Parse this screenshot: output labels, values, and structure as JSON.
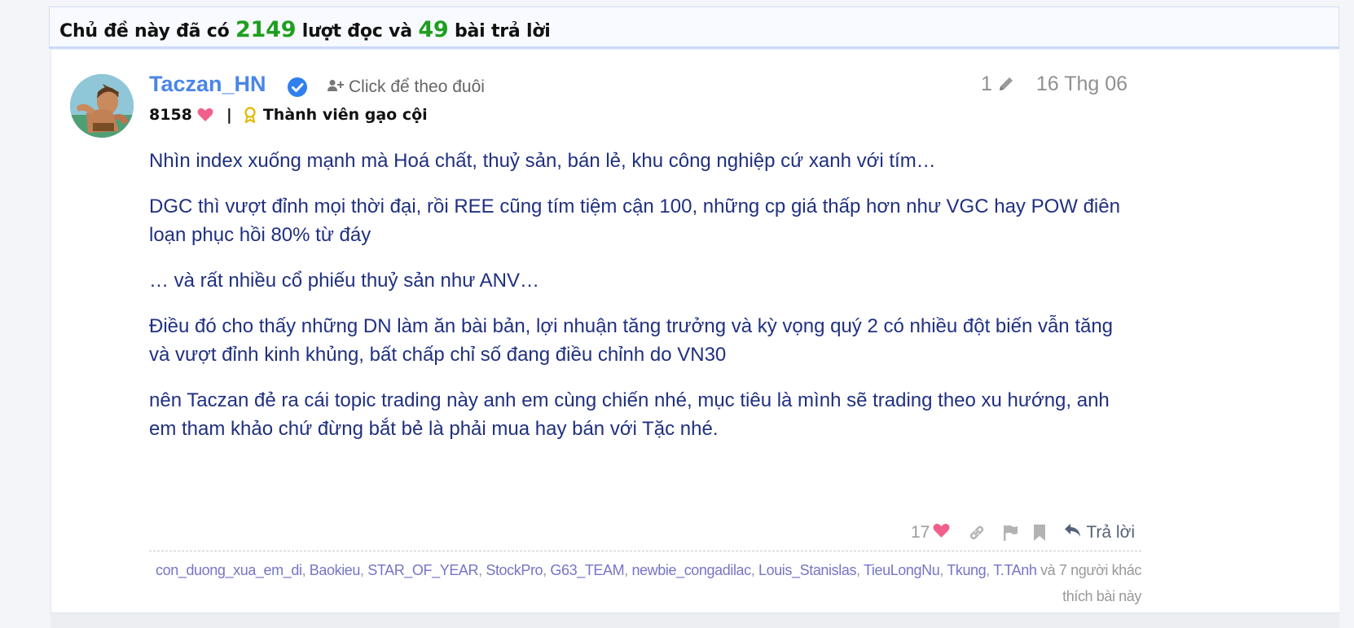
{
  "topic_header": {
    "prefix": "Chủ đề này đã có",
    "views": "2149",
    "middle": "lượt đọc và",
    "replies": "49",
    "suffix": "bài trả lời"
  },
  "post": {
    "username": "Taczan_HN",
    "follow_label": "Click để theo đuôi",
    "hearts": "8158",
    "rank": "Thành viên gạo cội",
    "post_number": "1",
    "date": "16 Thg 06",
    "paragraphs": [
      "Nhìn index xuống mạnh mà Hoá chất, thuỷ sản, bán lẻ, khu công nghiệp cứ xanh với tím…",
      "DGC thì vượt đỉnh mọi thời đại, rồi REE cũng tím tiệm cận 100, những cp giá thấp hơn như VGC hay POW điên loạn phục hồi 80% từ đáy",
      "… và rất nhiều cổ phiếu thuỷ sản như ANV…",
      "Điều đó cho thấy những DN làm ăn bài bản, lợi nhuận tăng trưởng và kỳ vọng quý 2 có nhiều đột biến vẫn tăng và vượt đỉnh kinh khủng, bất chấp chỉ số đang điều chỉnh do VN30",
      "nên Taczan đẻ ra cái topic trading này anh em cùng chiến nhé, mục tiêu là mình sẽ trading theo xu hướng, anh em tham khảo chứ đừng bắt bẻ là phải mua hay bán với Tặc nhé."
    ]
  },
  "actions": {
    "like_count": "17",
    "reply_label": "Trả lời"
  },
  "likers": {
    "names": [
      "con_duong_xua_em_di",
      "Baokieu",
      "STAR_OF_YEAR",
      "StockPro",
      "G63_TEAM",
      "newbie_congadilac",
      "Louis_Stanislas",
      "TieuLongNu",
      "Tkung",
      "T.TAnh"
    ],
    "suffix": "và 7 người khác thích bài này"
  },
  "colors": {
    "accent": "#4a86e8",
    "count_green": "#1f9e1f",
    "body_text": "#203080",
    "heart": "#f0608a",
    "liker_link": "#7575c8"
  },
  "icons": [
    "verified-badge-icon",
    "add-user-icon",
    "heart-icon",
    "award-icon",
    "pencil-icon",
    "link-icon",
    "flag-icon",
    "bookmark-icon",
    "reply-icon"
  ]
}
